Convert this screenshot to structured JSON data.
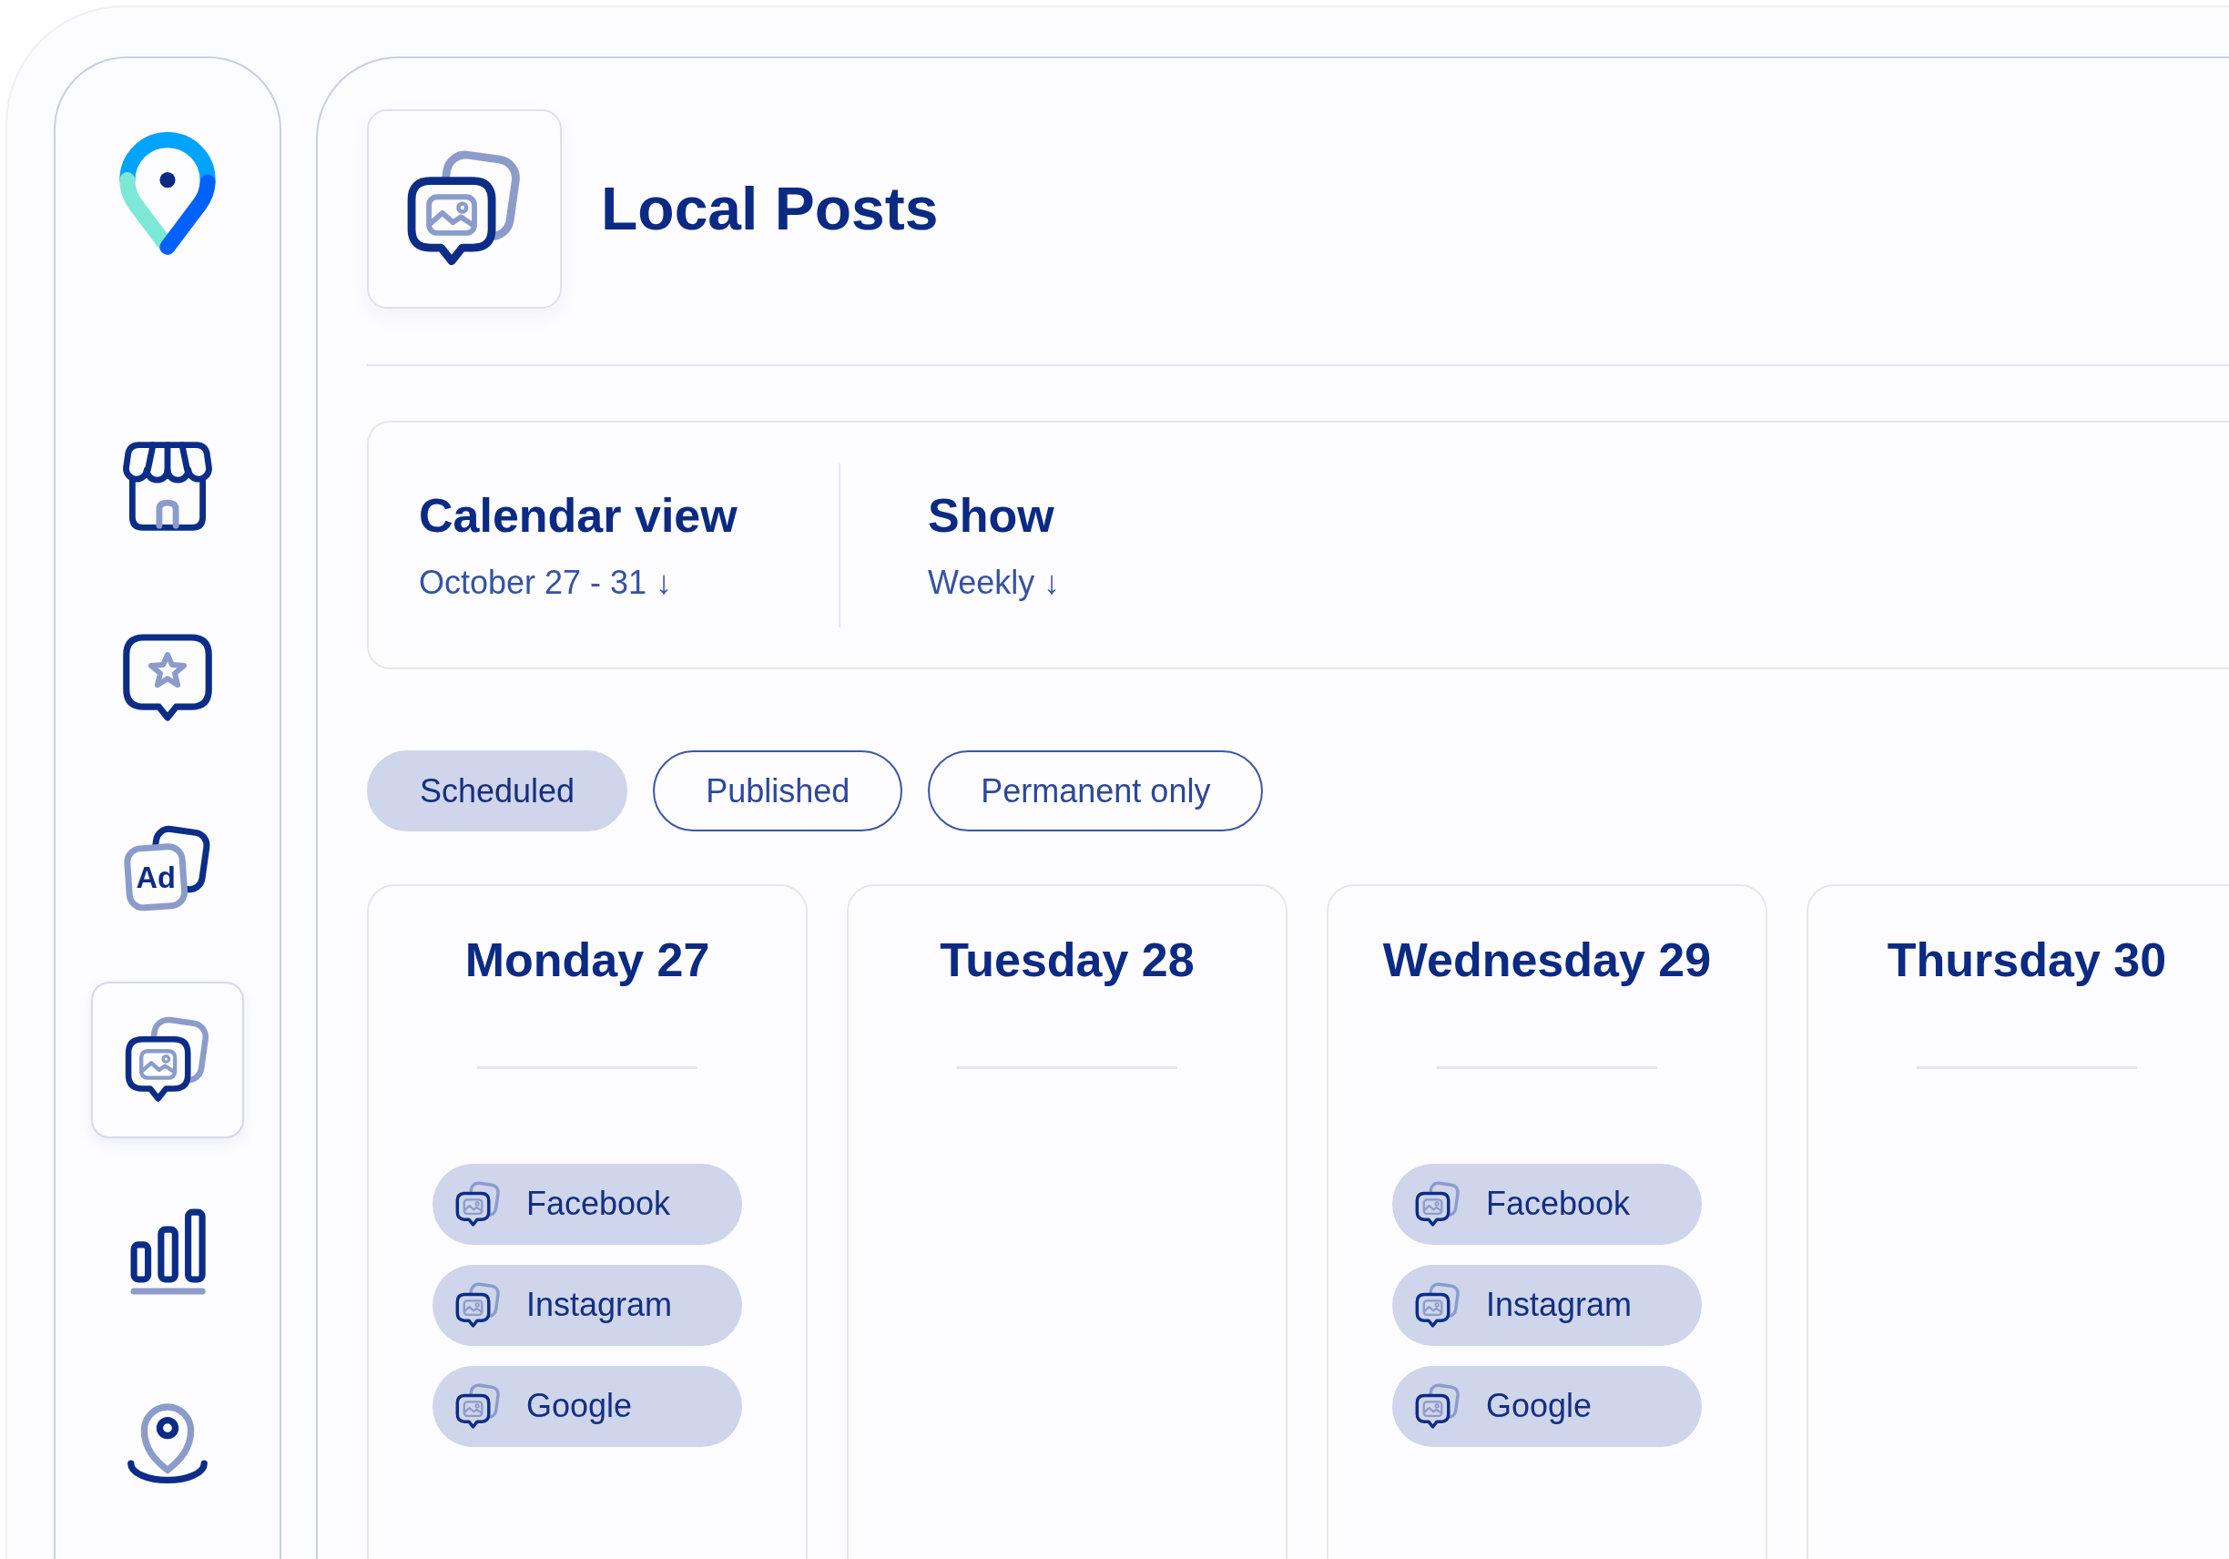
{
  "sidebar": {
    "items": [
      {
        "kind": "store",
        "selected": false
      },
      {
        "kind": "reviews",
        "selected": false
      },
      {
        "kind": "ads",
        "text": "Ad",
        "selected": false
      },
      {
        "kind": "posts",
        "selected": true
      },
      {
        "kind": "stats",
        "selected": false
      },
      {
        "kind": "location",
        "selected": false
      }
    ]
  },
  "page": {
    "title": "Local Posts"
  },
  "settings": [
    {
      "label": "Calendar view",
      "value": "October 27 - 31 ↓"
    },
    {
      "label": "Show",
      "value": "Weekly ↓"
    }
  ],
  "filters": [
    {
      "label": "Scheduled",
      "selected": true
    },
    {
      "label": "Published",
      "selected": false
    },
    {
      "label": "Permanent only",
      "selected": false
    }
  ],
  "days": [
    {
      "title": "Monday 27",
      "posts": [
        {
          "label": "Facebook"
        },
        {
          "label": "Instagram"
        },
        {
          "label": "Google"
        }
      ]
    },
    {
      "title": "Tuesday 28"
    },
    {
      "title": "Wednesday 29",
      "posts": [
        {
          "label": "Facebook"
        },
        {
          "label": "Instagram"
        },
        {
          "label": "Google"
        }
      ]
    },
    {
      "title": "Thursday 30"
    }
  ]
}
